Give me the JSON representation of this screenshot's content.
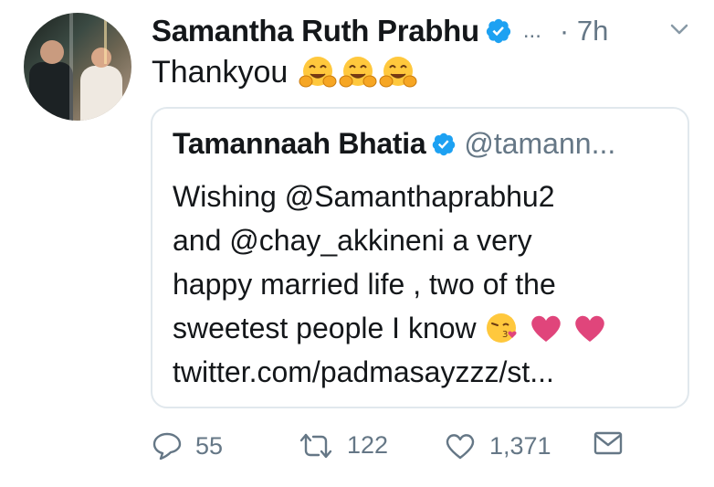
{
  "tweet": {
    "author_name": "Samantha Ruth Prabhu",
    "handle_truncation": "...",
    "time": "· 7h",
    "text": "Thankyou",
    "emoji": [
      "hugging-face-emoji",
      "hugging-face-emoji",
      "hugging-face-emoji"
    ]
  },
  "quoted_tweet": {
    "author_name": "Tamannaah Bhatia",
    "handle": "@tamann...",
    "lines": [
      "Wishing @Samanthaprabhu2",
      "and @chay_akkineni a very",
      "happy married life , two of the",
      "sweetest people I know",
      "twitter.com/padmasayzzz/st..."
    ],
    "line4_emoji": [
      "kissing-face-emoji",
      "heart-emoji",
      "heart-emoji"
    ]
  },
  "actions": {
    "replies": "55",
    "retweets": "122",
    "likes": "1,371"
  },
  "colors": {
    "verified_blue": "#1da1f2",
    "muted_text": "#657786",
    "border": "#e1e8ed",
    "heart_pink": "#e0457b"
  }
}
